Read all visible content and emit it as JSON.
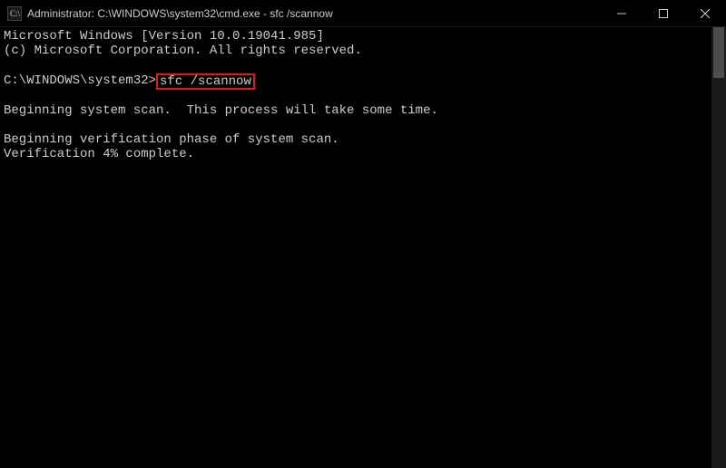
{
  "titlebar": {
    "title": "Administrator: C:\\WINDOWS\\system32\\cmd.exe - sfc  /scannow",
    "icon_name": "cmd-icon"
  },
  "window_controls": {
    "minimize": "minimize-icon",
    "maximize": "maximize-icon",
    "close": "close-icon"
  },
  "terminal": {
    "version_line": "Microsoft Windows [Version 10.0.19041.985]",
    "copyright_line": "(c) Microsoft Corporation. All rights reserved.",
    "prompt_path": "C:\\WINDOWS\\system32>",
    "command": "sfc /scannow",
    "scan_begin_line": "Beginning system scan.  This process will take some time.",
    "verification_begin_line": "Beginning verification phase of system scan.",
    "verification_progress_line": "Verification 4% complete."
  }
}
